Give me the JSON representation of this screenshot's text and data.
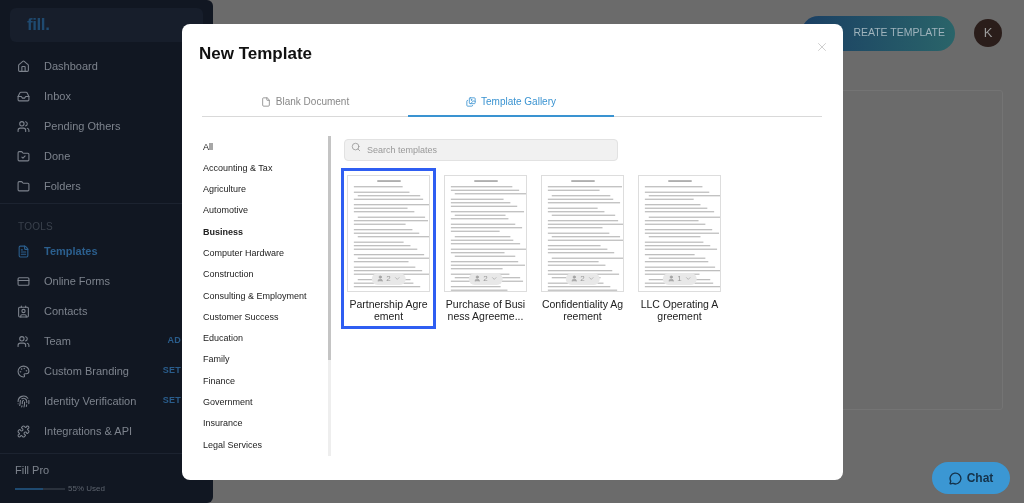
{
  "sidebar": {
    "logo": "fill.",
    "nav_items": [
      {
        "label": "Dashboard",
        "selected": false
      },
      {
        "label": "Inbox",
        "selected": false
      },
      {
        "label": "Pending Others",
        "selected": false
      },
      {
        "label": "Done",
        "selected": false
      },
      {
        "label": "Folders",
        "selected": false
      }
    ],
    "section_title": "TOOLS",
    "tool_items": [
      {
        "label": "Templates",
        "selected": true
      },
      {
        "label": "Online Forms",
        "selected": false
      },
      {
        "label": "Contacts",
        "selected": false
      },
      {
        "label": "Team",
        "selected": false,
        "badge": "AD"
      },
      {
        "label": "Custom Branding",
        "selected": false,
        "badge": "SET"
      },
      {
        "label": "Identity Verification",
        "selected": false,
        "badge": "SET"
      },
      {
        "label": "Integrations & API",
        "selected": false
      }
    ],
    "plan": {
      "name": "Fill Pro",
      "level": 0.55,
      "usage": "55% Used"
    }
  },
  "header": {
    "create_button": "REATE TEMPLATE",
    "avatar": "K"
  },
  "modal": {
    "title": "New Template",
    "tabs": [
      {
        "label": "Blank Document",
        "selected": false
      },
      {
        "label": "Template Gallery",
        "selected": true
      }
    ],
    "categories": [
      {
        "label": "All",
        "selected": false
      },
      {
        "label": "Accounting & Tax",
        "selected": false
      },
      {
        "label": "Agriculture",
        "selected": false
      },
      {
        "label": "Automotive",
        "selected": false
      },
      {
        "label": "Business",
        "selected": true
      },
      {
        "label": "Computer Hardware",
        "selected": false
      },
      {
        "label": "Construction",
        "selected": false
      },
      {
        "label": "Consulting & Employment",
        "selected": false
      },
      {
        "label": "Customer Success",
        "selected": false
      },
      {
        "label": "Education",
        "selected": false
      },
      {
        "label": "Family",
        "selected": false
      },
      {
        "label": "Finance",
        "selected": false
      },
      {
        "label": "Government",
        "selected": false
      },
      {
        "label": "Insurance",
        "selected": false
      },
      {
        "label": "Legal Services",
        "selected": false
      }
    ],
    "search": {
      "placeholder": "Search templates"
    },
    "templates": [
      {
        "title": "Partnership Agreement",
        "signers": "2",
        "selected": true
      },
      {
        "title": "Purchase of Business Agreeme...",
        "signers": "2",
        "selected": false
      },
      {
        "title": "Confidentiality Agreement",
        "signers": "2",
        "selected": false
      },
      {
        "title": "LLC Operating Agreement",
        "signers": "1",
        "selected": false
      }
    ]
  },
  "chat_button": "Chat"
}
